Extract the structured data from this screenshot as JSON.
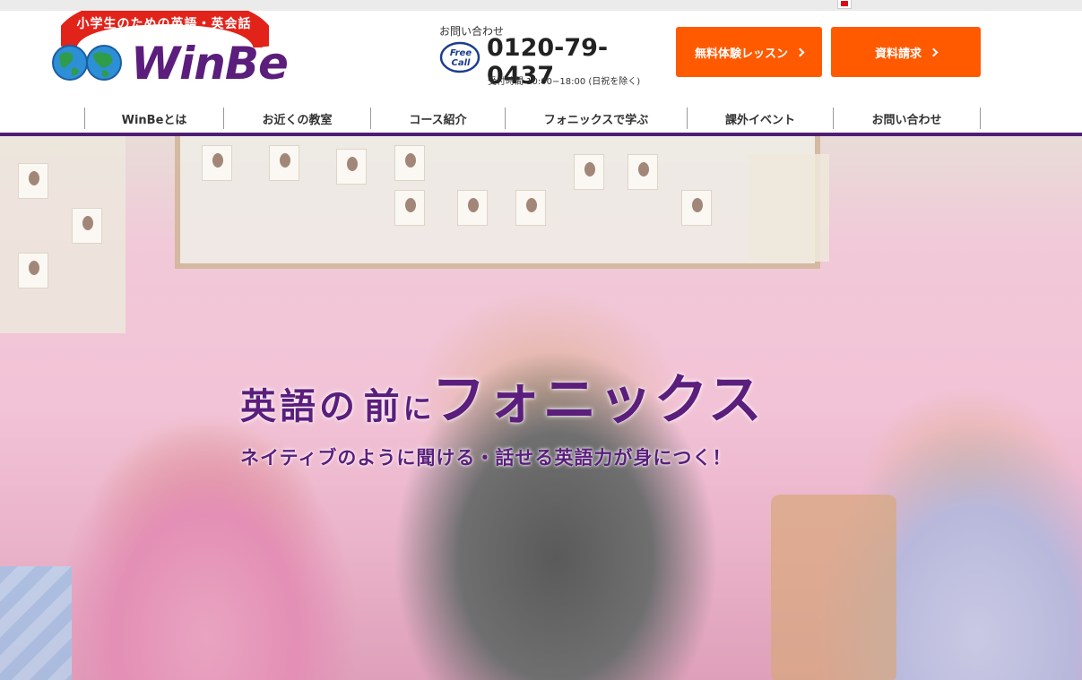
{
  "topbar": {
    "tagline": "",
    "logo_text": "",
    "accent": "#d80c18"
  },
  "header": {
    "logo": {
      "banner": "小学生のための英語・英会話",
      "wordmark": "WinBe",
      "icon": "globe-icon"
    },
    "contact": {
      "label": "お問い合わせ",
      "freecall_line1": "Free",
      "freecall_line2": "Call",
      "phone": "0120-79-0437",
      "hours": "受付時間 10:00−18:00 (日祝を除く)"
    },
    "buttons": {
      "trial": "無料体験レッスン",
      "docs": "資料請求"
    }
  },
  "nav": {
    "items": [
      {
        "label": "WinBeとは"
      },
      {
        "label": "お近くの教室"
      },
      {
        "label": "コース紹介"
      },
      {
        "label": "フォニックスで学ぶ"
      },
      {
        "label": "課外イベント"
      },
      {
        "label": "お問い合わせ"
      }
    ]
  },
  "hero": {
    "headline_part1": "英語",
    "headline_part2": "の",
    "headline_part3": "前",
    "headline_part4": "に",
    "headline_part5": "フォニックス",
    "subcopy": "ネイティブのように聞ける・話せる英語力が身につく！"
  },
  "colors": {
    "brand_purple": "#5b1e7c",
    "cta_orange": "#ff5a00",
    "nav_rule": "#4f1d74",
    "logo_red": "#e2231a"
  }
}
